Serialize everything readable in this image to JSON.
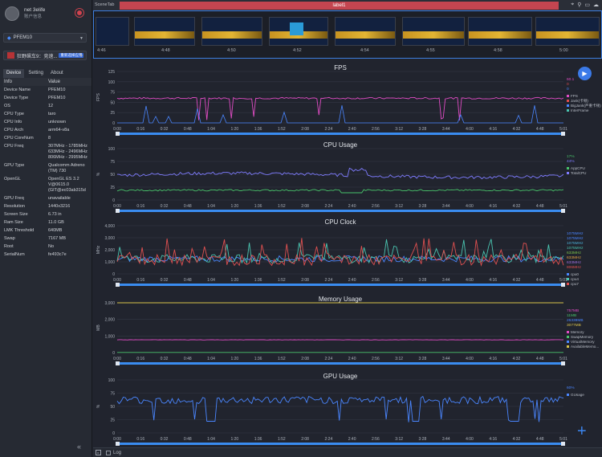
{
  "user": {
    "name": "net 3elife",
    "subtitle": "账户信息"
  },
  "device_select": {
    "value": "PFEM10"
  },
  "app_select": {
    "value": "狂野飙车9：竞速...",
    "badge": "重新选择应用"
  },
  "tabs": [
    {
      "label": "Device"
    },
    {
      "label": "Setting"
    },
    {
      "label": "About"
    }
  ],
  "table": {
    "headers": [
      "Info",
      "Value"
    ],
    "rows": [
      {
        "k": "Device Name",
        "v": "PFEM10"
      },
      {
        "k": "Device Type",
        "v": "PFEM10"
      },
      {
        "k": "OS",
        "v": "12"
      },
      {
        "k": "CPU Type",
        "v": "taro"
      },
      {
        "k": "CPU Info",
        "v": "unknown"
      },
      {
        "k": "CPU Arch",
        "v": "arm64-v8a"
      },
      {
        "k": "CPU CoreNum",
        "v": "8"
      },
      {
        "k": "CPU Freq",
        "v": "307MHz - 1785MHz\n633MHz - 2496MHz\n806MHz - 2995MHz"
      },
      {
        "k": "GPU Type",
        "v": "Qualcomm Adreno (TM) 730"
      },
      {
        "k": "OpenGL",
        "v": "OpenGL ES 3.2 V@0615.0 (GIT@ec03ab315d"
      },
      {
        "k": "GPU Freq",
        "v": "unavailable"
      },
      {
        "k": "Resolution",
        "v": "1440x3216"
      },
      {
        "k": "Screen Size",
        "v": "6.73 in"
      },
      {
        "k": "Ram Size",
        "v": "11.0 GB"
      },
      {
        "k": "LMK Threshold",
        "v": "640MB"
      },
      {
        "k": "Swap",
        "v": "7167 MB"
      },
      {
        "k": "Root",
        "v": "No"
      },
      {
        "k": "SerialNum",
        "v": "fe493c7e"
      }
    ]
  },
  "scene": {
    "tab_label": "SceneTab",
    "label": "label1"
  },
  "timeline": {
    "labels": [
      "4:46",
      "4:48",
      "4:50",
      "4:52",
      "4:54",
      "4:55",
      "4:58",
      "5:00"
    ]
  },
  "bottom": {
    "log_label": "Log"
  },
  "time_ticks": [
    "0:00",
    "0:16",
    "0:32",
    "0:48",
    "1:04",
    "1:20",
    "1:36",
    "1:52",
    "2:08",
    "2:24",
    "2:40",
    "2:56",
    "3:12",
    "3:28",
    "3:44",
    "4:00",
    "4:16",
    "4:32",
    "4:48",
    "5:01"
  ],
  "colors": {
    "accent": "#3b7ae8",
    "label_bar": "#c44550",
    "fps": "#e04cc4",
    "jank": "#4a86ff",
    "cpu_app": "#7f7cff",
    "cpu_total": "#48c26a"
  },
  "chart_data": [
    {
      "type": "line",
      "title": "FPS",
      "ylabel": "FPS",
      "ylim": [
        0,
        125
      ],
      "yticks": [
        "125",
        "100",
        "75",
        "50",
        "25",
        "0"
      ],
      "legend_values": [
        {
          "text": "60.1",
          "color": "#e04cc4"
        },
        {
          "text": "0",
          "color": "#e04c4c"
        },
        {
          "text": "0",
          "color": "#4a86ff"
        }
      ],
      "series": [
        {
          "name": "FPS",
          "color": "#e04cc4"
        },
        {
          "name": "Jank(卡顿)",
          "color": "#e04c4c"
        },
        {
          "name": "BigJank(严重卡顿)",
          "color": "#4a86ff"
        },
        {
          "name": "InterFrame",
          "color": "#4ac4b0"
        }
      ]
    },
    {
      "type": "line",
      "title": "CPU Usage",
      "ylabel": "%",
      "ylim": [
        0,
        100
      ],
      "yticks": [
        "100",
        "75",
        "50",
        "25",
        "0"
      ],
      "legend_values": [
        {
          "text": "17%",
          "color": "#48c26a"
        },
        {
          "text": "44%",
          "color": "#7f7cff"
        }
      ],
      "series": [
        {
          "name": "AppCPU",
          "color": "#48c26a"
        },
        {
          "name": "TotalCPU",
          "color": "#7f7cff"
        }
      ]
    },
    {
      "type": "line",
      "title": "CPU Clock",
      "ylabel": "MHz",
      "ylim": [
        0,
        4000
      ],
      "yticks": [
        "4,000",
        "3,000",
        "2,000",
        "1,000",
        "0"
      ],
      "legend_values": [
        {
          "text": "1075MHz",
          "color": "#4a86ff"
        },
        {
          "text": "1075MHz",
          "color": "#4a86ff"
        },
        {
          "text": "1075MHz",
          "color": "#4ab0d8"
        },
        {
          "text": "1075MHz",
          "color": "#4ac4b0"
        },
        {
          "text": "633MHz",
          "color": "#7cc44a"
        },
        {
          "text": "633MHz",
          "color": "#e0a040"
        },
        {
          "text": "633MHz",
          "color": "#a070e0"
        },
        {
          "text": "806MHz",
          "color": "#e05050"
        }
      ],
      "series": [
        {
          "name": "cpu0",
          "color": "#4a86ff"
        },
        {
          "name": "cpu4",
          "color": "#4ac4b0"
        },
        {
          "name": "cpu7",
          "color": "#e05050"
        }
      ]
    },
    {
      "type": "line",
      "title": "Memory Usage",
      "ylabel": "MB",
      "ylim": [
        0,
        3000
      ],
      "yticks": [
        "3,000",
        "2,000",
        "1,000",
        "0"
      ],
      "legend_values": [
        {
          "text": "757MB",
          "color": "#e04cc4"
        },
        {
          "text": "11MB",
          "color": "#48c26a"
        },
        {
          "text": "26339MB",
          "color": "#4a86ff"
        },
        {
          "text": "3077MB",
          "color": "#d8c24a"
        }
      ],
      "series": [
        {
          "name": "Memory",
          "color": "#e04cc4"
        },
        {
          "name": "SwapMemory",
          "color": "#48c26a"
        },
        {
          "name": "VirtualMemory",
          "color": "#4a86ff"
        },
        {
          "name": "AvailableMemo...",
          "color": "#d8c24a"
        }
      ]
    },
    {
      "type": "line",
      "title": "GPU Usage",
      "ylabel": "%",
      "ylim": [
        0,
        100
      ],
      "yticks": [
        "100",
        "75",
        "50",
        "25",
        "0"
      ],
      "legend_values": [
        {
          "text": "60%",
          "color": "#4a86ff"
        }
      ],
      "series": [
        {
          "name": "GUsage",
          "color": "#4a86ff"
        }
      ]
    }
  ]
}
